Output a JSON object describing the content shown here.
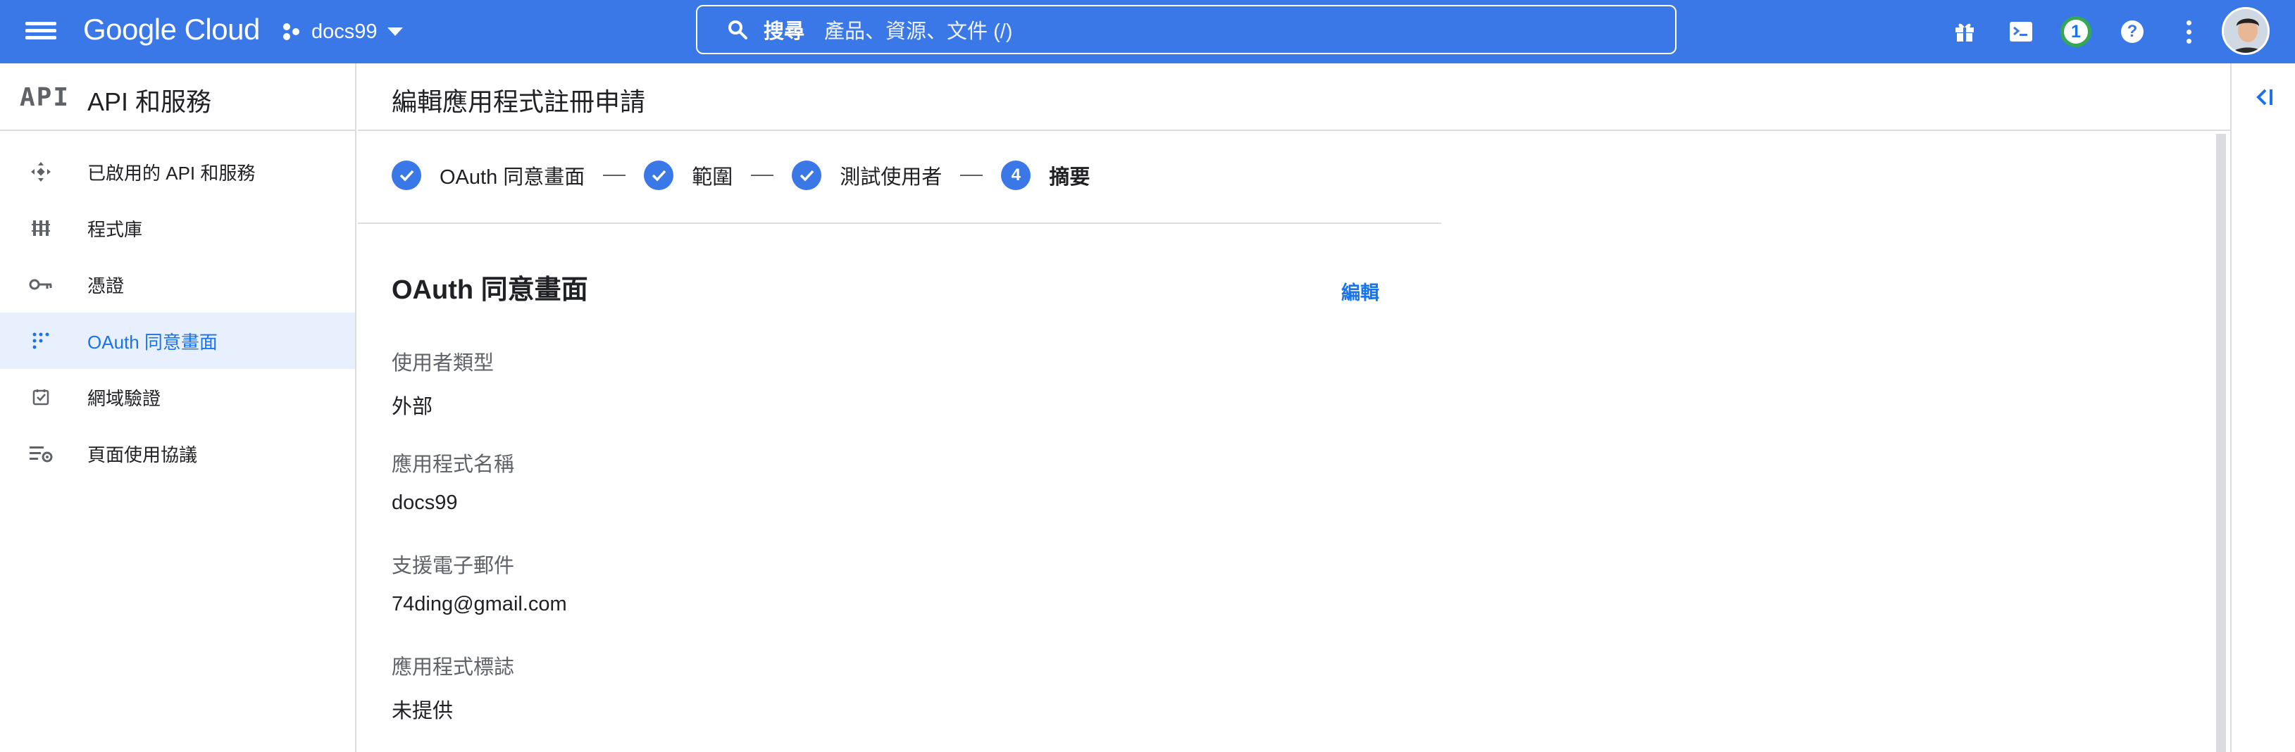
{
  "topbar": {
    "logo": "Google Cloud",
    "project": "docs99",
    "search_label": "搜尋",
    "search_placeholder": "產品、資源、文件 (/)",
    "notification_count": "1",
    "accent": "#3b78e7"
  },
  "sidebar": {
    "logo_text": "API",
    "title": "API 和服務",
    "items": [
      {
        "label": "已啟用的 API 和服務",
        "icon": "api-hub-icon",
        "active": false
      },
      {
        "label": "程式庫",
        "icon": "library-icon",
        "active": false
      },
      {
        "label": "憑證",
        "icon": "key-icon",
        "active": false
      },
      {
        "label": "OAuth 同意畫面",
        "icon": "oauth-grid-icon",
        "active": true
      },
      {
        "label": "網域驗證",
        "icon": "checkbox-icon",
        "active": false
      },
      {
        "label": "頁面使用協議",
        "icon": "settings-list-icon",
        "active": false
      }
    ]
  },
  "main": {
    "page_title": "編輯應用程式註冊申請",
    "steps": [
      {
        "label": "OAuth 同意畫面",
        "status": "done"
      },
      {
        "label": "範圍",
        "status": "done"
      },
      {
        "label": "測試使用者",
        "status": "done"
      },
      {
        "label": "摘要",
        "status": "current",
        "number": "4"
      }
    ],
    "section_title": "OAuth 同意畫面",
    "edit_label": "編輯",
    "fields": [
      {
        "label": "使用者類型",
        "value": "外部"
      },
      {
        "label": "應用程式名稱",
        "value": "docs99"
      },
      {
        "label": "支援電子郵件",
        "value": "74ding@gmail.com"
      },
      {
        "label": "應用程式標誌",
        "value": "未提供"
      }
    ]
  }
}
